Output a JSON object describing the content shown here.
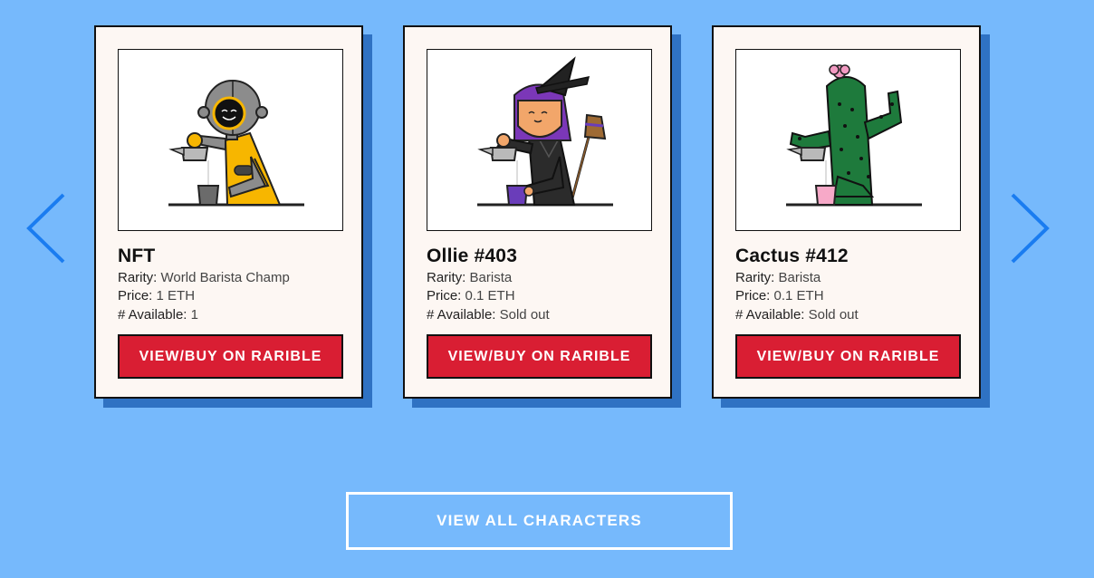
{
  "nav": {
    "prev_icon": "chevron-left-icon",
    "next_icon": "chevron-right-icon",
    "arrow_color": "#1a7cf0"
  },
  "cards": [
    {
      "title": "NFT",
      "image": "robot-barista-illustration",
      "rarity_label": "Rarity:",
      "rarity": "World Barista Champ",
      "price_label": "Price:",
      "price": "1 ETH",
      "available_label": "# Available:",
      "available": "1",
      "button_label": "VIEW/BUY ON RARIBLE"
    },
    {
      "title": "Ollie #403",
      "image": "witch-barista-illustration",
      "rarity_label": "Rarity:",
      "rarity": "Barista",
      "price_label": "Price:",
      "price": "0.1 ETH",
      "available_label": "# Available:",
      "available": "Sold out",
      "button_label": "VIEW/BUY ON RARIBLE"
    },
    {
      "title": "Cactus #412",
      "image": "cactus-barista-illustration",
      "rarity_label": "Rarity:",
      "rarity": "Barista",
      "price_label": "Price:",
      "price": "0.1 ETH",
      "available_label": "# Available:",
      "available": "Sold out",
      "button_label": "VIEW/BUY ON RARIBLE"
    }
  ],
  "view_all_label": "VIEW ALL CHARACTERS",
  "colors": {
    "background": "#76b9fc",
    "card_shadow": "#2f72c3",
    "button_red": "#d91e33",
    "card_bg": "#fdf7f3"
  }
}
